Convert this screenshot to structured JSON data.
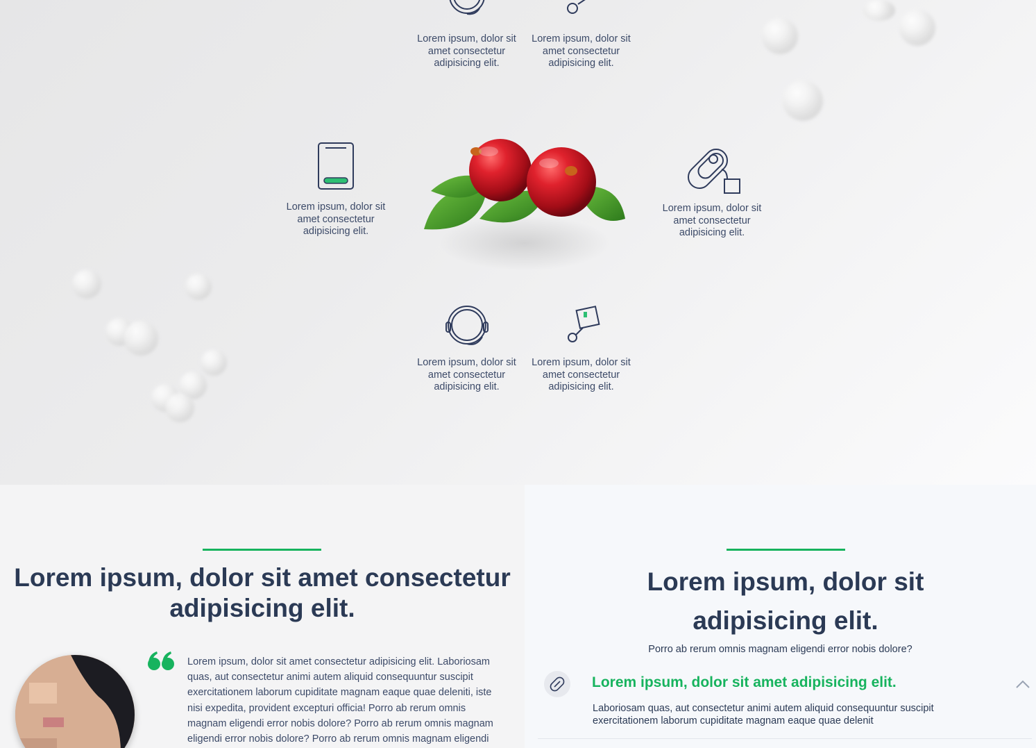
{
  "hero": {
    "features": [
      {
        "id": "top-left",
        "text": "Lorem ipsum, dolor sit amet consectetur adipisicing elit."
      },
      {
        "id": "top-right",
        "text": "Lorem ipsum, dolor sit amet consectetur adipisicing elit."
      },
      {
        "id": "mid-left",
        "text": "Lorem ipsum, dolor sit amet consectetur adipisicing elit."
      },
      {
        "id": "mid-right",
        "text": "Lorem ipsum, dolor sit amet consectetur adipisicing elit."
      },
      {
        "id": "bottom-left",
        "text": "Lorem ipsum, dolor sit amet consectetur adipisicing elit."
      },
      {
        "id": "bottom-right",
        "text": "Lorem ipsum, dolor sit amet consectetur adipisicing elit."
      }
    ],
    "icons": {
      "top_left": "headset-icon",
      "top_right": "tag-icon",
      "mid_left": "tablet-icon",
      "mid_right": "capsule-icon",
      "bottom_left": "headset-icon",
      "bottom_right": "tag-icon"
    }
  },
  "testimonial_section": {
    "heading_line1": "Lorem ipsum, dolor sit amet consectetur",
    "heading_line2": "adipisicing elit.",
    "quote": "Lorem ipsum, dolor sit amet consectetur adipisicing elit. Laboriosam quas, aut consectetur animi autem aliquid consequuntur suscipit exercitationem laborum cupiditate magnam eaque quae deleniti, iste nisi expedita, provident excepturi officia! Porro ab rerum omnis magnam eligendi error nobis dolore? Porro ab rerum omnis magnam eligendi error nobis dolore? Porro ab rerum omnis magnam eligendi"
  },
  "faq_section": {
    "heading_line1": "Lorem ipsum, dolor sit",
    "heading_line2": "adipisicing elit.",
    "subtext": "Porro ab rerum omnis magnam eligendi error nobis dolore?",
    "item": {
      "title": "Lorem ipsum, dolor sit amet adipisicing elit.",
      "body": "Laboriosam quas, aut consectetur animi autem aliquid consequuntur suscipit exercitationem laborum cupiditate magnam eaque quae delenit",
      "icon": "pill-icon",
      "expanded": true
    }
  },
  "colors": {
    "accent": "#17b35e",
    "heading": "#2b3a55",
    "icon_stroke": "#2f3b5c"
  }
}
